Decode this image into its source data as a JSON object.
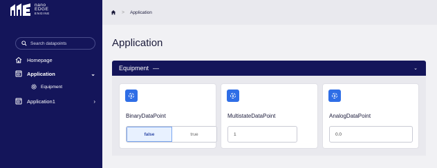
{
  "logo": {
    "line1": "nano",
    "line2": "EDGE",
    "line3": "ENGINE"
  },
  "search": {
    "placeholder": "Search datapoints"
  },
  "sidebar": {
    "items": [
      {
        "label": "Homepage",
        "icon": "home-icon"
      },
      {
        "label": "Application",
        "icon": "app-window-icon",
        "expanded": true
      },
      {
        "label": "Equipment",
        "icon": "gear-icon"
      },
      {
        "label": "Application1",
        "icon": "app-window-icon",
        "expanded": false
      }
    ]
  },
  "breadcrumb": {
    "home_icon": "home-icon",
    "separator": ">",
    "current": "Application"
  },
  "page": {
    "title": "Application"
  },
  "panel": {
    "title": "Equipment",
    "dash": "—"
  },
  "cards": [
    {
      "label": "BinaryDataPoint",
      "options": [
        "false",
        "true"
      ],
      "selected": "false"
    },
    {
      "label": "MultistateDataPoint",
      "value": "1"
    },
    {
      "label": "AnalogDataPoint",
      "value": "0.0"
    }
  ],
  "colors": {
    "sidebar": "#14155a",
    "accent": "#2f6ee6",
    "background": "#f1f1f4"
  }
}
